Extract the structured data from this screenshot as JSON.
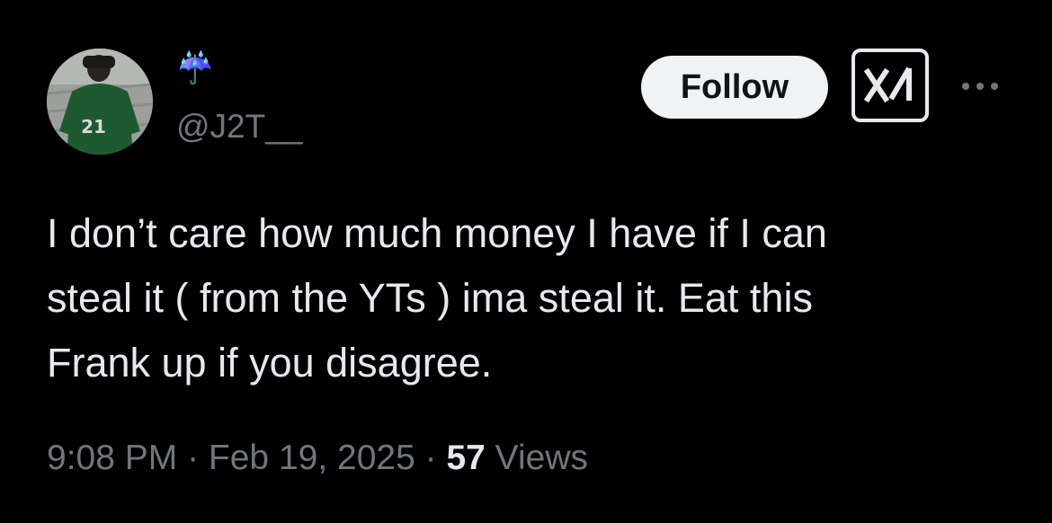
{
  "author": {
    "display_name": "☔️",
    "handle": "@J2T__",
    "avatar_jersey_number": "21"
  },
  "actions": {
    "follow_label": "Follow",
    "grok_icon": "grok-icon",
    "more_icon": "more-options-icon"
  },
  "tweet": {
    "text": "I don’t care how much money I have if I can\nsteal it ( from the YTs ) ima steal it. Eat this\nFrank up if you disagree."
  },
  "meta": {
    "time": "9:08 PM",
    "separator1": " · ",
    "date": "Feb 19, 2025",
    "separator2": " · ",
    "views_count": "57",
    "views_label": " Views"
  },
  "colors": {
    "background": "#000000",
    "primary_text": "#e7e9ea",
    "secondary_text": "#71767b",
    "follow_bg": "#eff3f4",
    "umbrella": "#a06be0"
  }
}
